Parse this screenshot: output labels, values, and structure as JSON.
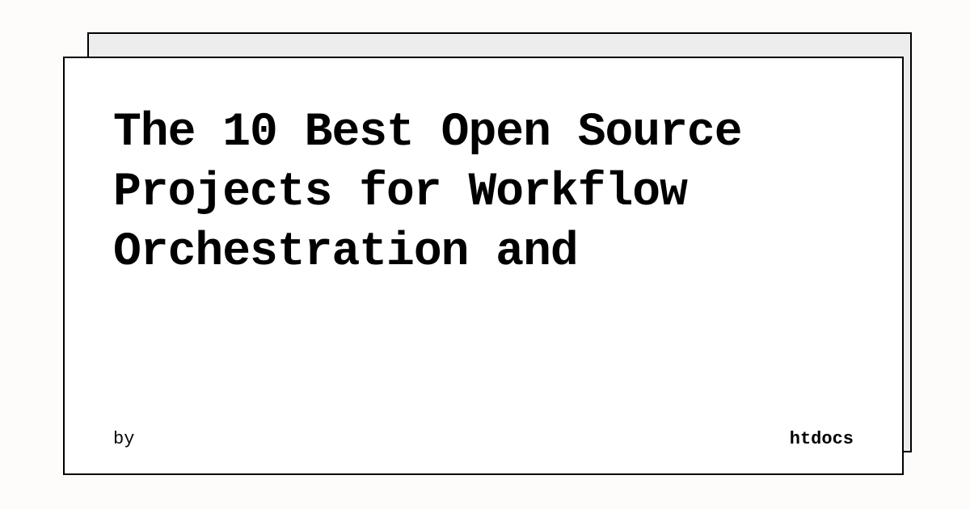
{
  "card": {
    "title": "The 10 Best Open Source Projects for Workflow Orchestration and",
    "byLabel": "by",
    "brand": "htdocs"
  }
}
